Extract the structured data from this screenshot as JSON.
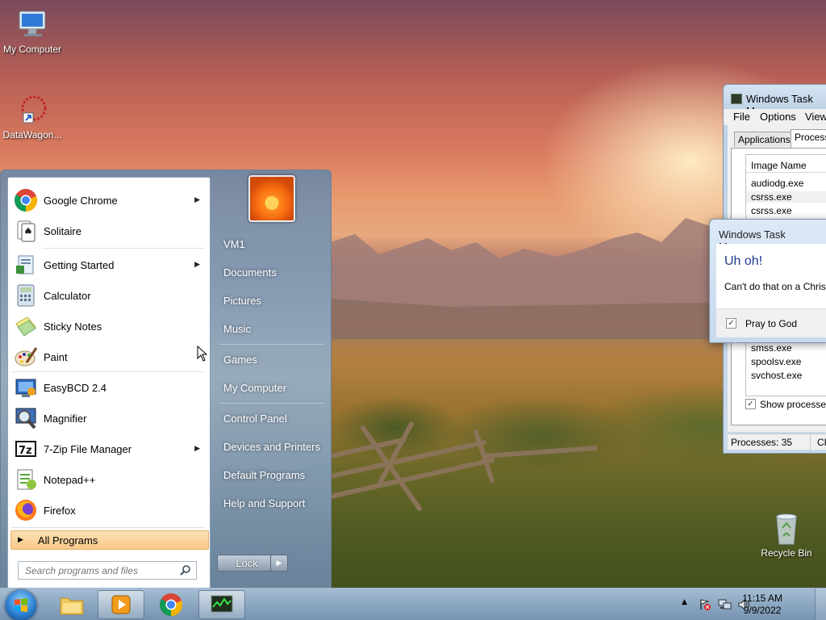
{
  "desktop": {
    "icons": [
      {
        "label": "My Computer"
      },
      {
        "label": "DataWagon..."
      },
      {
        "label": "Recycle Bin"
      }
    ]
  },
  "start_menu": {
    "programs": [
      {
        "label": "Google Chrome",
        "icon": "chrome-icon",
        "submenu": true
      },
      {
        "label": "Solitaire",
        "icon": "solitaire-icon",
        "submenu": false
      },
      {
        "label": "Getting Started",
        "icon": "getting-started-icon",
        "submenu": true
      },
      {
        "label": "Calculator",
        "icon": "calculator-icon",
        "submenu": false
      },
      {
        "label": "Sticky Notes",
        "icon": "sticky-notes-icon",
        "submenu": false
      },
      {
        "label": "Paint",
        "icon": "paint-icon",
        "submenu": false
      },
      {
        "label": "EasyBCD 2.4",
        "icon": "easybcd-icon",
        "submenu": false
      },
      {
        "label": "Magnifier",
        "icon": "magnifier-icon",
        "submenu": false
      },
      {
        "label": "7-Zip File Manager",
        "icon": "7zip-icon",
        "submenu": true
      },
      {
        "label": "Notepad++",
        "icon": "notepadpp-icon",
        "submenu": false
      },
      {
        "label": "Firefox",
        "icon": "firefox-icon",
        "submenu": false
      }
    ],
    "all_programs": "All Programs",
    "search_placeholder": "Search programs and files",
    "right_items": [
      "VM1",
      "Documents",
      "Pictures",
      "Music",
      "Games",
      "My Computer",
      "Control Panel",
      "Devices and Printers",
      "Default Programs",
      "Help and Support"
    ],
    "lock_label": "Lock"
  },
  "task_manager": {
    "title": "Windows Task Man",
    "menu": [
      "File",
      "Options",
      "View"
    ],
    "tabs": [
      "Applications",
      "Processe"
    ],
    "column_header": "Image Name",
    "processes_top": [
      "audiodg.exe",
      "csrss.exe",
      "csrss.exe"
    ],
    "processes_bottom": [
      "smss.exe",
      "spoolsv.exe",
      "svchost.exe"
    ],
    "show_processes": "Show processes f",
    "status_processes": "Processes: 35",
    "status_cpu": "CP"
  },
  "dialog": {
    "title": "Windows Task Manager",
    "heading": "Uh oh!",
    "message": "Can't do that on a Christ",
    "checkbox_label": "Pray to God",
    "checkbox_checked": true
  },
  "taskbar": {
    "time": "11:15 AM",
    "date": "9/9/2022"
  },
  "colors": {
    "accent": "#1e3d8f",
    "all_programs_bg": "#f9c88a"
  }
}
